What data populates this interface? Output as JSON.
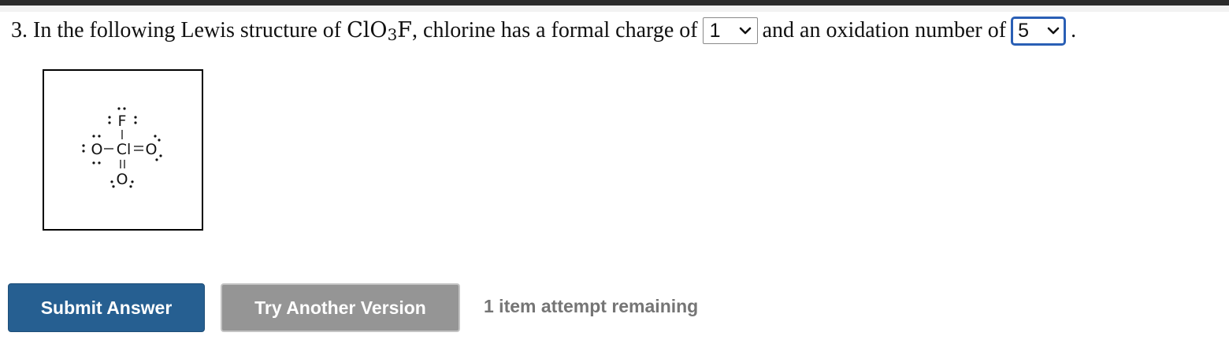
{
  "question": {
    "number": "3.",
    "text_before": "In the following Lewis structure of",
    "formula": {
      "part1": "ClO",
      "subscript": "3",
      "part2": "F"
    },
    "text_middle": ", chlorine has a formal charge of",
    "formal_charge_value": "1",
    "text_between": "and an oxidation number of",
    "oxidation_number_value": "5",
    "text_end": "."
  },
  "lewis_structure": {
    "atoms": {
      "top": "F",
      "center": "Cl",
      "left": "O",
      "right": "O",
      "bottom": "O"
    }
  },
  "buttons": {
    "submit_label": "Submit Answer",
    "try_another_label": "Try Another Version"
  },
  "attempts_text": "1 item attempt remaining",
  "colors": {
    "submit_bg": "#265f91",
    "try_bg": "#959595",
    "focus_border": "#2a5fb5",
    "attempts_text": "#757575"
  },
  "icons": {
    "select_arrow": "chevron-down-icon"
  }
}
